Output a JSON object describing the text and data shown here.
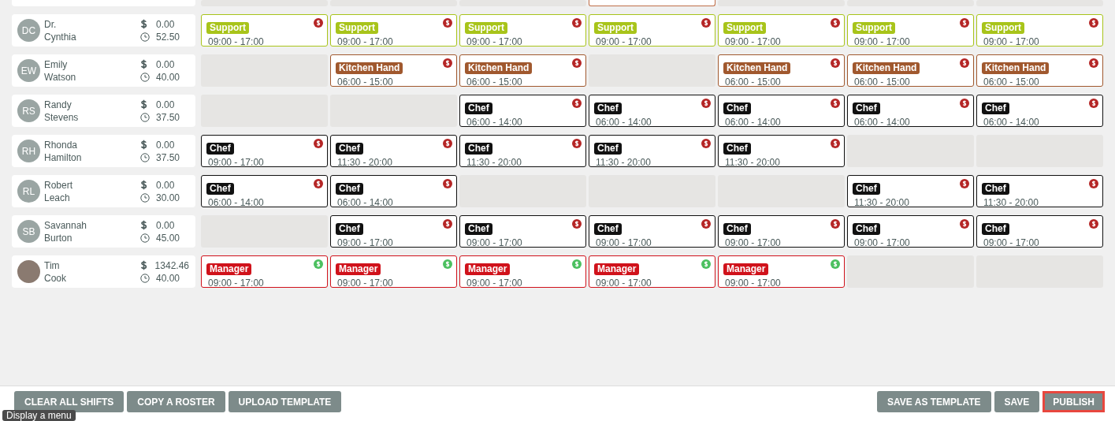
{
  "top_row": {
    "days": [
      {
        "kind": "empty"
      },
      {
        "kind": "empty"
      },
      {
        "kind": "empty"
      },
      {
        "kind": "cut_shift",
        "color": "#c0704a"
      },
      {
        "kind": "empty"
      },
      {
        "kind": "empty"
      },
      {
        "kind": "empty"
      }
    ]
  },
  "employees": [
    {
      "avatar": {
        "kind": "initials",
        "initials": "DC"
      },
      "first_name": "Dr.",
      "last_name": "Cynthia",
      "cost": "0.00",
      "hours": "52.50",
      "days": [
        {
          "kind": "shift",
          "role": "Support",
          "color": "#a8c41a",
          "time": "09:00 - 17:00",
          "paid": false
        },
        {
          "kind": "shift",
          "role": "Support",
          "color": "#a8c41a",
          "time": "09:00 - 17:00",
          "paid": false
        },
        {
          "kind": "shift",
          "role": "Support",
          "color": "#a8c41a",
          "time": "09:00 - 17:00",
          "paid": false
        },
        {
          "kind": "shift",
          "role": "Support",
          "color": "#a8c41a",
          "time": "09:00 - 17:00",
          "paid": false
        },
        {
          "kind": "shift",
          "role": "Support",
          "color": "#a8c41a",
          "time": "09:00 - 17:00",
          "paid": false
        },
        {
          "kind": "shift",
          "role": "Support",
          "color": "#a8c41a",
          "time": "09:00 - 17:00",
          "paid": false
        },
        {
          "kind": "shift",
          "role": "Support",
          "color": "#a8c41a",
          "time": "09:00 - 17:00",
          "paid": false
        }
      ]
    },
    {
      "avatar": {
        "kind": "initials",
        "initials": "EW"
      },
      "first_name": "Emily",
      "last_name": "Watson",
      "cost": "0.00",
      "hours": "40.00",
      "days": [
        {
          "kind": "empty"
        },
        {
          "kind": "shift",
          "role": "Kitchen Hand",
          "color": "#a0582e",
          "time": "06:00 - 15:00",
          "paid": false
        },
        {
          "kind": "shift",
          "role": "Kitchen Hand",
          "color": "#a0582e",
          "time": "06:00 - 15:00",
          "paid": false
        },
        {
          "kind": "empty"
        },
        {
          "kind": "shift",
          "role": "Kitchen Hand",
          "color": "#a0582e",
          "time": "06:00 - 15:00",
          "paid": false
        },
        {
          "kind": "shift",
          "role": "Kitchen Hand",
          "color": "#a0582e",
          "time": "06:00 - 15:00",
          "paid": false
        },
        {
          "kind": "shift",
          "role": "Kitchen Hand",
          "color": "#a0582e",
          "time": "06:00 - 15:00",
          "paid": false
        }
      ]
    },
    {
      "avatar": {
        "kind": "initials",
        "initials": "RS"
      },
      "first_name": "Randy",
      "last_name": "Stevens",
      "cost": "0.00",
      "hours": "37.50",
      "days": [
        {
          "kind": "empty"
        },
        {
          "kind": "empty"
        },
        {
          "kind": "shift",
          "role": "Chef",
          "color": "#111111",
          "time": "06:00 - 14:00",
          "paid": false
        },
        {
          "kind": "shift",
          "role": "Chef",
          "color": "#111111",
          "time": "06:00 - 14:00",
          "paid": false
        },
        {
          "kind": "shift",
          "role": "Chef",
          "color": "#111111",
          "time": "06:00 - 14:00",
          "paid": false
        },
        {
          "kind": "shift",
          "role": "Chef",
          "color": "#111111",
          "time": "06:00 - 14:00",
          "paid": false
        },
        {
          "kind": "shift",
          "role": "Chef",
          "color": "#111111",
          "time": "06:00 - 14:00",
          "paid": false
        }
      ]
    },
    {
      "avatar": {
        "kind": "initials",
        "initials": "RH"
      },
      "first_name": "Rhonda",
      "last_name": "Hamilton",
      "cost": "0.00",
      "hours": "37.50",
      "days": [
        {
          "kind": "shift",
          "role": "Chef",
          "color": "#111111",
          "time": "09:00 - 17:00",
          "paid": false
        },
        {
          "kind": "shift",
          "role": "Chef",
          "color": "#111111",
          "time": "11:30 - 20:00",
          "paid": false
        },
        {
          "kind": "shift",
          "role": "Chef",
          "color": "#111111",
          "time": "11:30 - 20:00",
          "paid": false
        },
        {
          "kind": "shift",
          "role": "Chef",
          "color": "#111111",
          "time": "11:30 - 20:00",
          "paid": false
        },
        {
          "kind": "shift",
          "role": "Chef",
          "color": "#111111",
          "time": "11:30 - 20:00",
          "paid": false
        },
        {
          "kind": "empty"
        },
        {
          "kind": "empty"
        }
      ]
    },
    {
      "avatar": {
        "kind": "initials",
        "initials": "RL"
      },
      "first_name": "Robert",
      "last_name": "Leach",
      "cost": "0.00",
      "hours": "30.00",
      "days": [
        {
          "kind": "shift",
          "role": "Chef",
          "color": "#111111",
          "time": "06:00 - 14:00",
          "paid": false
        },
        {
          "kind": "shift",
          "role": "Chef",
          "color": "#111111",
          "time": "06:00 - 14:00",
          "paid": false
        },
        {
          "kind": "empty"
        },
        {
          "kind": "empty"
        },
        {
          "kind": "empty"
        },
        {
          "kind": "shift",
          "role": "Chef",
          "color": "#111111",
          "time": "11:30 - 20:00",
          "paid": false
        },
        {
          "kind": "shift",
          "role": "Chef",
          "color": "#111111",
          "time": "11:30 - 20:00",
          "paid": false
        }
      ]
    },
    {
      "avatar": {
        "kind": "initials",
        "initials": "SB"
      },
      "first_name": "Savannah",
      "last_name": "Burton",
      "cost": "0.00",
      "hours": "45.00",
      "days": [
        {
          "kind": "empty"
        },
        {
          "kind": "shift",
          "role": "Chef",
          "color": "#111111",
          "time": "09:00 - 17:00",
          "paid": false
        },
        {
          "kind": "shift",
          "role": "Chef",
          "color": "#111111",
          "time": "09:00 - 17:00",
          "paid": false
        },
        {
          "kind": "shift",
          "role": "Chef",
          "color": "#111111",
          "time": "09:00 - 17:00",
          "paid": false
        },
        {
          "kind": "shift",
          "role": "Chef",
          "color": "#111111",
          "time": "09:00 - 17:00",
          "paid": false
        },
        {
          "kind": "shift",
          "role": "Chef",
          "color": "#111111",
          "time": "09:00 - 17:00",
          "paid": false
        },
        {
          "kind": "shift",
          "role": "Chef",
          "color": "#111111",
          "time": "09:00 - 17:00",
          "paid": false
        }
      ]
    },
    {
      "avatar": {
        "kind": "photo"
      },
      "first_name": "Tim",
      "last_name": "Cook",
      "cost": "1342.46",
      "hours": "40.00",
      "days": [
        {
          "kind": "shift",
          "role": "Manager",
          "color": "#d0121b",
          "time": "09:00 - 17:00",
          "paid": true
        },
        {
          "kind": "shift",
          "role": "Manager",
          "color": "#d0121b",
          "time": "09:00 - 17:00",
          "paid": true
        },
        {
          "kind": "shift",
          "role": "Manager",
          "color": "#d0121b",
          "time": "09:00 - 17:00",
          "paid": true
        },
        {
          "kind": "shift",
          "role": "Manager",
          "color": "#d0121b",
          "time": "09:00 - 17:00",
          "paid": true
        },
        {
          "kind": "shift",
          "role": "Manager",
          "color": "#d0121b",
          "time": "09:00 - 17:00",
          "paid": true
        },
        {
          "kind": "empty"
        },
        {
          "kind": "empty"
        }
      ]
    }
  ],
  "footer": {
    "left_buttons": [
      {
        "label": "CLEAR ALL SHIFTS",
        "highlighted": false
      },
      {
        "label": "COPY A ROSTER",
        "highlighted": false
      },
      {
        "label": "UPLOAD TEMPLATE",
        "highlighted": false
      }
    ],
    "right_buttons": [
      {
        "label": "SAVE AS TEMPLATE",
        "highlighted": false
      },
      {
        "label": "SAVE",
        "highlighted": false
      },
      {
        "label": "PUBLISH",
        "highlighted": true
      }
    ]
  },
  "tooltip": "Display a menu"
}
